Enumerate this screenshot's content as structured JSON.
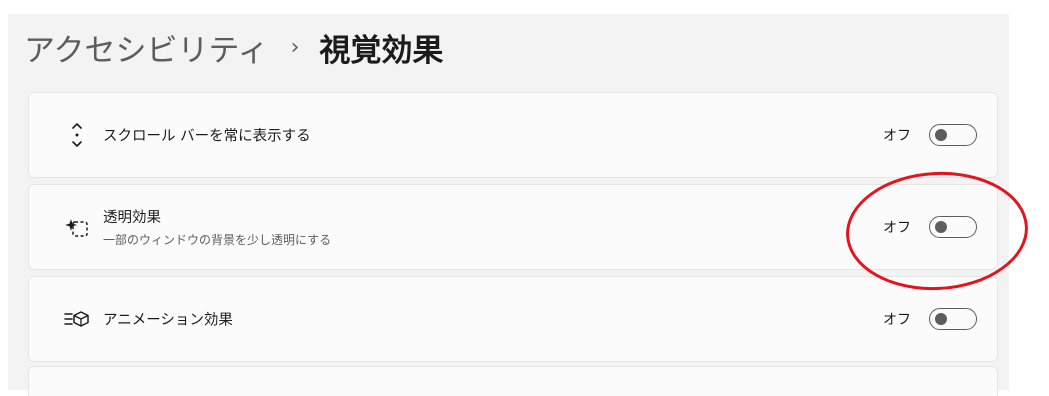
{
  "breadcrumb": {
    "parent": "アクセシビリティ",
    "separator": "›",
    "current": "視覚効果"
  },
  "settings": [
    {
      "icon": "scrollbar-icon",
      "title": "スクロール バーを常に表示する",
      "description": "",
      "state_label": "オフ",
      "enabled": false
    },
    {
      "icon": "transparency-icon",
      "title": "透明効果",
      "description": "一部のウィンドウの背景を少し透明にする",
      "state_label": "オフ",
      "enabled": false
    },
    {
      "icon": "animation-icon",
      "title": "アニメーション効果",
      "description": "",
      "state_label": "オフ",
      "enabled": false
    }
  ],
  "colors": {
    "background": "#f3f3f3",
    "card": "#fbfbfb",
    "annotation": "#e4141f"
  }
}
